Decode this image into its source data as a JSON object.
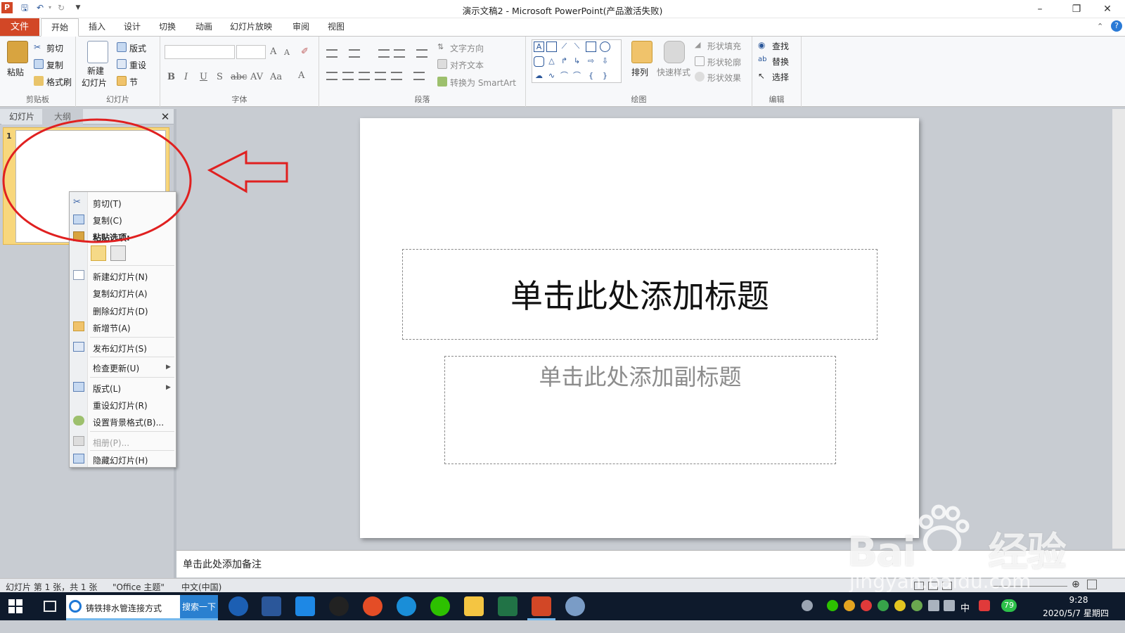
{
  "window": {
    "title": "演示文稿2  -  Microsoft PowerPoint(产品激活失败)",
    "app_icon": "P"
  },
  "ribbon_tabs": [
    "文件",
    "开始",
    "插入",
    "设计",
    "切换",
    "动画",
    "幻灯片放映",
    "审阅",
    "视图"
  ],
  "ribbon": {
    "clipboard": {
      "paste": "粘贴",
      "cut": "剪切",
      "copy": "复制",
      "format_painter": "格式刷",
      "label": "剪贴板"
    },
    "slides": {
      "new_slide": "新建",
      "new_slide2": "幻灯片",
      "layout": "版式",
      "reset": "重设",
      "section": "节",
      "label": "幻灯片"
    },
    "font": {
      "label": "字体"
    },
    "paragraph": {
      "text_direction": "文字方向",
      "align_text": "对齐文本",
      "smartart": "转换为 SmartArt",
      "label": "段落"
    },
    "drawing": {
      "arrange": "排列",
      "quick_styles": "快速样式",
      "shape_fill": "形状填充",
      "shape_outline": "形状轮廓",
      "shape_effects": "形状效果",
      "label": "绘图"
    },
    "editing": {
      "find": "查找",
      "replace": "替换",
      "select": "选择",
      "label": "编辑"
    }
  },
  "pane": {
    "tab_slides": "幻灯片",
    "tab_outline": "大纲",
    "thumb_number": "1"
  },
  "slide": {
    "title_placeholder": "单击此处添加标题",
    "subtitle_placeholder": "单击此处添加副标题"
  },
  "notes": {
    "placeholder": "单击此处添加备注"
  },
  "context_menu": {
    "cut": "剪切(T)",
    "copy": "复制(C)",
    "paste_options": "粘贴选项:",
    "new_slide": "新建幻灯片(N)",
    "duplicate_slide": "复制幻灯片(A)",
    "delete_slide": "删除幻灯片(D)",
    "add_section": "新增节(A)",
    "publish_slides": "发布幻灯片(S)",
    "check_updates": "检查更新(U)",
    "layout": "版式(L)",
    "reset_slide": "重设幻灯片(R)",
    "format_background": "设置背景格式(B)...",
    "photo_album": "相册(P)...",
    "hide_slide": "隐藏幻灯片(H)"
  },
  "status": {
    "slide_info": "幻灯片 第 1 张，共 1 张",
    "theme": "\"Office 主题\"",
    "language": "中文(中国)"
  },
  "taskbar": {
    "search_text": "铸铁排水管连接方式",
    "search_button": "搜索一下",
    "time": "9:28",
    "date": "2020/5/7 星期四",
    "badge": "79",
    "ime": "中"
  },
  "watermark": {
    "brand": "Bai",
    "brand2": "经验",
    "url": "jingyan.baidu.com"
  },
  "colors": {
    "file_tab": "#d24726",
    "annotation_red": "#e02020",
    "thumb_selected": "#f8d77c",
    "taskbar": "#0e1a2c"
  }
}
